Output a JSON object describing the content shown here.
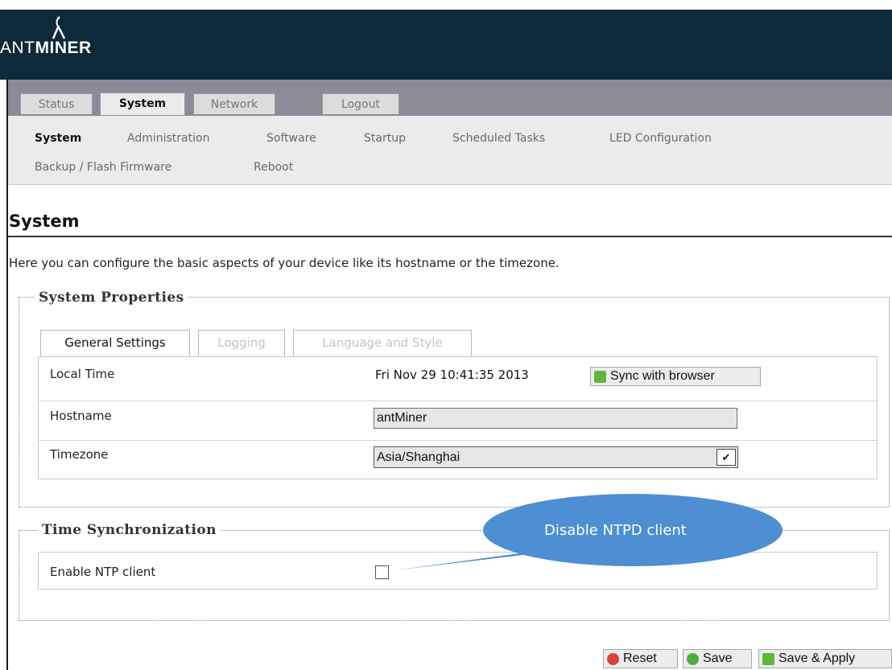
{
  "app": {
    "logo_prefix": "ANT",
    "logo_bold": "MINER"
  },
  "colors": {
    "header_bg": "#0e2a3a",
    "tabbar_bg": "#8b8b98",
    "callout_bg": "#4d8fd2"
  },
  "main_tabs": [
    {
      "label": "Status",
      "active": false
    },
    {
      "label": "System",
      "active": true
    },
    {
      "label": "Network",
      "active": false
    },
    {
      "label": "Logout",
      "active": false
    }
  ],
  "sub_tabs": [
    {
      "label": "System",
      "active": true
    },
    {
      "label": "Administration",
      "active": false
    },
    {
      "label": "Software",
      "active": false
    },
    {
      "label": "Startup",
      "active": false
    },
    {
      "label": "Scheduled Tasks",
      "active": false
    },
    {
      "label": "LED Configuration",
      "active": false
    },
    {
      "label": "Backup / Flash Firmware",
      "active": false
    },
    {
      "label": "Reboot",
      "active": false
    }
  ],
  "page": {
    "title": "System",
    "description": "Here you can configure the basic aspects of your device like its hostname or the timezone."
  },
  "system_properties": {
    "legend": "System Properties",
    "tabs": [
      {
        "label": "General Settings",
        "active": true
      },
      {
        "label": "Logging",
        "active": false
      },
      {
        "label": "Language and Style",
        "active": false
      }
    ],
    "local_time_label": "Local Time",
    "local_time_value": "Fri Nov 29 10:41:35 2013",
    "sync_button": "Sync with browser",
    "hostname_label": "Hostname",
    "hostname_value": "antMiner",
    "timezone_label": "Timezone",
    "timezone_value": "Asia/Shanghai"
  },
  "time_sync": {
    "legend": "Time Synchronization",
    "ntp_label": "Enable NTP client",
    "ntp_checked": false
  },
  "callout": {
    "text": "Disable NTPD client"
  },
  "actions": {
    "reset": "Reset",
    "save": "Save",
    "save_apply": "Save & Apply"
  }
}
